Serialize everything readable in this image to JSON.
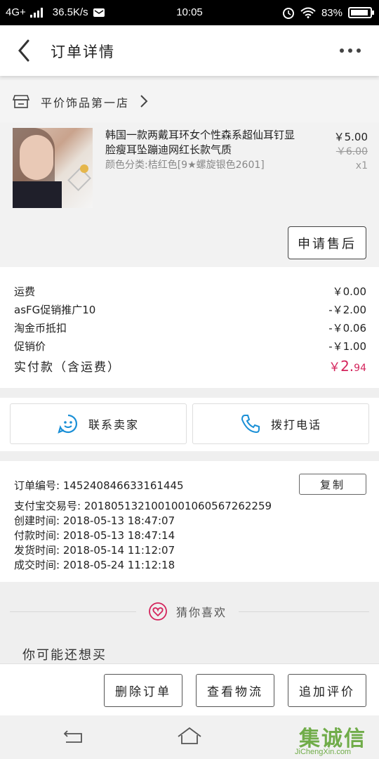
{
  "status_bar": {
    "network": "4G+",
    "speed": "36.5K/s",
    "time": "10:05",
    "battery": "83%"
  },
  "header": {
    "title": "订单详情"
  },
  "store": {
    "name": "平价饰品第一店"
  },
  "product": {
    "title": "韩国一款两戴耳环女个性森系超仙耳钉显脸瘦耳坠蹦迪网红长款气质",
    "variant": "颜色分类:桔红色[9★螺旋银色2601]",
    "price": "￥5.00",
    "original_price": "￥6.00",
    "quantity": "x1",
    "after_sale_label": "申请售后"
  },
  "fees": [
    {
      "label": "运费",
      "value": "￥0.00"
    },
    {
      "label": "asFG促销推广10",
      "value": "-￥2.00"
    },
    {
      "label": "淘金币抵扣",
      "value": "-￥0.06"
    },
    {
      "label": "促销价",
      "value": "-￥1.00"
    }
  ],
  "total": {
    "label": "实付款（含运费）",
    "symbol": "￥",
    "int": "2.",
    "dec": "94"
  },
  "contact": {
    "seller_label": "联系卖家",
    "call_label": "拨打电话"
  },
  "order_info": {
    "order_no": "订单编号: 145240846633161445",
    "copy_label": "复制",
    "alipay_no": "支付宝交易号: 2018051321001001060567262259",
    "created": "创建时间: 2018-05-13 18:47:07",
    "paid": "付款时间: 2018-05-13 18:47:14",
    "shipped": "发货时间: 2018-05-14 11:12:07",
    "completed": "成交时间: 2018-05-24 11:12:18"
  },
  "guess": {
    "label": "猜你喜欢",
    "maybe_buy": "你可能还想买"
  },
  "actions": {
    "delete": "删除订单",
    "logistics": "查看物流",
    "review": "追加评价"
  },
  "watermark": {
    "cn": "集诚信",
    "en": "JiChengXin.com"
  },
  "colors": {
    "accent": "#d4245c",
    "icon_blue": "#1a8fd6",
    "watermark": "#5aa02c"
  }
}
